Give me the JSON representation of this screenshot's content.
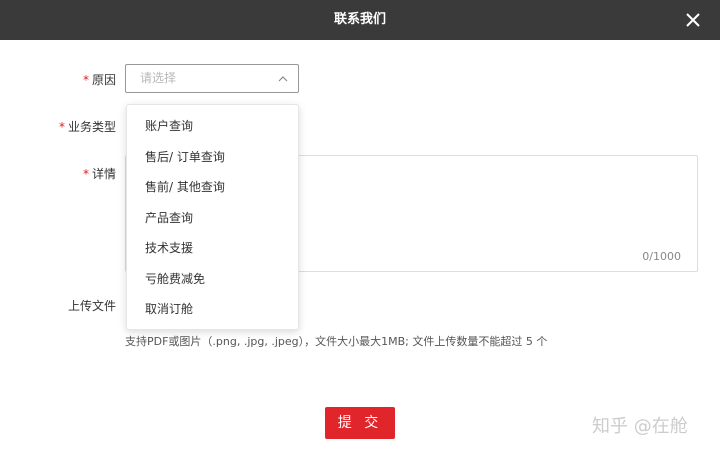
{
  "dialog": {
    "title": "联系我们",
    "close_icon": "close-icon"
  },
  "form": {
    "reason": {
      "required_mark": "*",
      "label": "原因",
      "placeholder": "请选择",
      "state": "open"
    },
    "business_type": {
      "required_mark": "*",
      "label": "业务类型"
    },
    "details": {
      "required_mark": "*",
      "label": "详情",
      "counter": "0/1000"
    },
    "upload": {
      "label": "上传文件",
      "hint": "支持PDF或图片（.png, .jpg, .jpeg），文件大小最大1MB; 文件上传数量不能超过 5 个"
    },
    "submit_label": "提 交"
  },
  "dropdown": {
    "items": [
      "账户查询",
      "售后/ 订单查询",
      "售前/ 其他查询",
      "产品查询",
      "技术支援",
      "亏舱费减免",
      "取消订舱"
    ]
  },
  "watermark": "知乎 @在舱",
  "colors": {
    "header_bg": "#3a3a3a",
    "required": "#e02020",
    "submit_bg": "#e0262b"
  }
}
